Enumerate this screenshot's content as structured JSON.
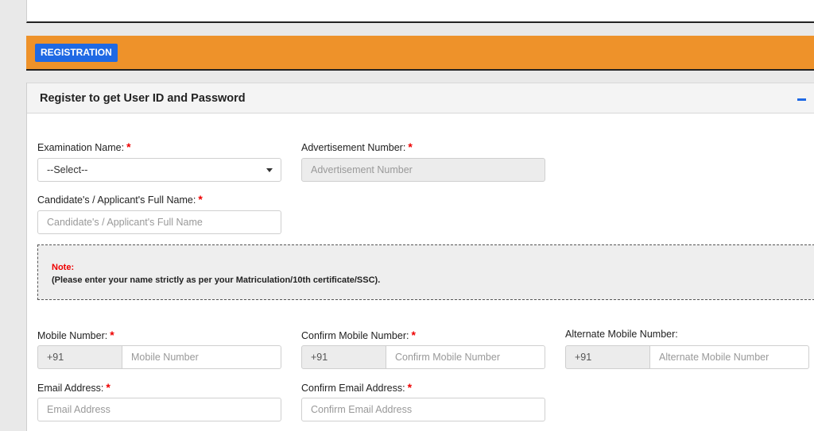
{
  "header": {
    "registration_label": "REGISTRATION"
  },
  "panel": {
    "title": "Register to get User ID and Password"
  },
  "form": {
    "exam_name": {
      "label": "Examination Name:",
      "required": "*",
      "selected": "--Select--"
    },
    "advertisement": {
      "label": "Advertisement Number:",
      "required": "*",
      "placeholder": "Advertisement Number"
    },
    "full_name": {
      "label": "Candidate's / Applicant's Full Name:",
      "required": "*",
      "placeholder": "Candidate's / Applicant's Full Name"
    },
    "note": {
      "title": "Note:",
      "text": "(Please enter your name strictly as per your Matriculation/10th certificate/SSC)."
    },
    "mobile": {
      "label": "Mobile Number:",
      "required": "*",
      "prefix": "+91",
      "placeholder": "Mobile Number"
    },
    "confirm_mobile": {
      "label": "Confirm Mobile Number:",
      "required": "*",
      "prefix": "+91",
      "placeholder": "Confirm Mobile Number"
    },
    "alt_mobile": {
      "label": "Alternate Mobile Number:",
      "prefix": "+91",
      "placeholder": "Alternate Mobile Number"
    },
    "email": {
      "label": "Email Address:",
      "required": "*",
      "placeholder": "Email Address"
    },
    "confirm_email": {
      "label": "Confirm Email Address:",
      "required": "*",
      "placeholder": "Confirm Email Address"
    }
  },
  "colors": {
    "accent": "#1f69e4",
    "orange": "#ee922a",
    "required": "#ee0000"
  }
}
